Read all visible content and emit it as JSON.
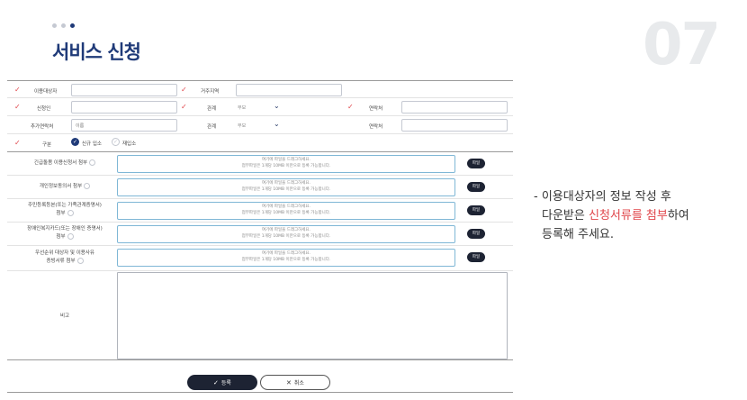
{
  "header": {
    "title": "서비스 신청",
    "page_number": "07",
    "dot_colors": [
      "#c5c9d2",
      "#c5c9d2",
      "#1f3a78"
    ]
  },
  "form": {
    "row1": {
      "target_label": "이용대상자",
      "target_value": "",
      "region_label": "거주지역",
      "region_value": ""
    },
    "row2": {
      "applicant_label": "신청인",
      "applicant_value": "",
      "relation_label": "관계",
      "relation_value": "부모",
      "contact_label": "연락처",
      "contact_value": ""
    },
    "row3": {
      "extra_contact_label": "추가연락처",
      "extra_contact_placeholder": "이름",
      "relation_label": "관계",
      "relation_value": "부모",
      "contact_label": "연락처",
      "contact_value": ""
    },
    "row4": {
      "type_label": "구분",
      "option_new": "신규 입소",
      "option_re": "재입소"
    },
    "file_rows": [
      {
        "label_line1": "긴급돌봄 이용신청서 첨부",
        "label_line2": ""
      },
      {
        "label_line1": "개인정보동의서 첨부",
        "label_line2": ""
      },
      {
        "label_line1": "주민등록등본(또는 가족관계증명서)",
        "label_line2": "첨부"
      },
      {
        "label_line1": "장애인복지카드(또는 장애인 증명서)",
        "label_line2": "첨부"
      },
      {
        "label_line1": "우선순위 대상자 및 이용사유",
        "label_line2": "증빙서류 첨부"
      }
    ],
    "drop_text_line1": "여기에 파일을 드래그하세요.",
    "drop_text_line2": "첨부파일은 1개당 10MB 이만으로 등록 가능합니다.",
    "file_button": "파일",
    "remarks_label": "비고",
    "remarks_value": ""
  },
  "buttons": {
    "submit": "등록",
    "cancel": "취소"
  },
  "note": {
    "line1": "- 이용대상자의 정보 작성 후",
    "line2_pre": "다운받은 ",
    "line2_highlight": "신청서류를 첨부",
    "line2_post": "하여",
    "line3": "등록해 주세요."
  },
  "colors": {
    "title": "#1f3a78",
    "required_mark": "#e0454a",
    "button_dark": "#1d2333",
    "drop_border": "#7fb7d6",
    "highlight": "#e0454a"
  }
}
